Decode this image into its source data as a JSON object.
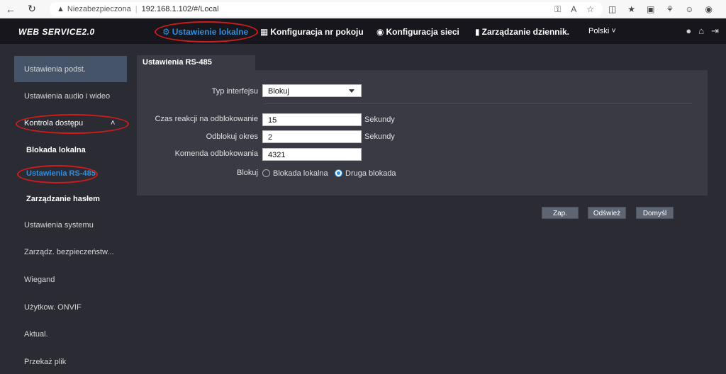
{
  "browser": {
    "security_label": "Niezabezpieczona",
    "url_host": "192.168.1.102",
    "url_path": "/#/Local"
  },
  "app": {
    "logo": "WEB SERVICE2.0",
    "nav": [
      {
        "label": "Ustawienie lokalne",
        "icon": "gear-icon",
        "active": true
      },
      {
        "label": "Konfiguracja nr pokoju",
        "icon": "building-icon"
      },
      {
        "label": "Konfiguracja sieci",
        "icon": "globe-icon"
      },
      {
        "label": "Zarządzanie dziennik.",
        "icon": "document-icon"
      }
    ],
    "language": "Polski"
  },
  "sidebar": {
    "items": [
      {
        "label": "Ustawienia podst."
      },
      {
        "label": "Ustawienia audio i wideo"
      },
      {
        "label": "Kontrola dostępu"
      },
      {
        "label": "Blokada lokalna"
      },
      {
        "label": "Ustawienia RS-485"
      },
      {
        "label": "Zarządzanie hasłem"
      },
      {
        "label": "Ustawienia systemu"
      },
      {
        "label": "Zarządz. bezpieczeństw..."
      },
      {
        "label": "Wiegand"
      },
      {
        "label": "Użytkow. ONVIF"
      },
      {
        "label": "Aktual."
      },
      {
        "label": "Przekaż plik"
      }
    ]
  },
  "main": {
    "tab": "Ustawienia RS-485",
    "form": {
      "interface_type_label": "Typ interfejsu",
      "interface_type_value": "Blokuj",
      "unlock_response_label": "Czas reakcji na odblokowanie",
      "unlock_response_value": "15",
      "unlock_period_label": "Odblokuj okres",
      "unlock_period_value": "2",
      "unlock_command_label": "Komenda odblokowania",
      "unlock_command_value": "4321",
      "unit_seconds": "Sekundy",
      "lock_label": "Blokuj",
      "lock_options": [
        "Blokada lokalna",
        "Druga blokada"
      ],
      "lock_selected": "Druga blokada"
    },
    "buttons": {
      "save": "Zap.",
      "refresh": "Odśwież",
      "default": "Domyśl"
    }
  },
  "colors": {
    "accent": "#2f8fe0",
    "annotation": "#d31b1b",
    "header_bg": "#16161c",
    "page_bg": "#2b2b33",
    "panel_bg": "#3a3a45"
  }
}
